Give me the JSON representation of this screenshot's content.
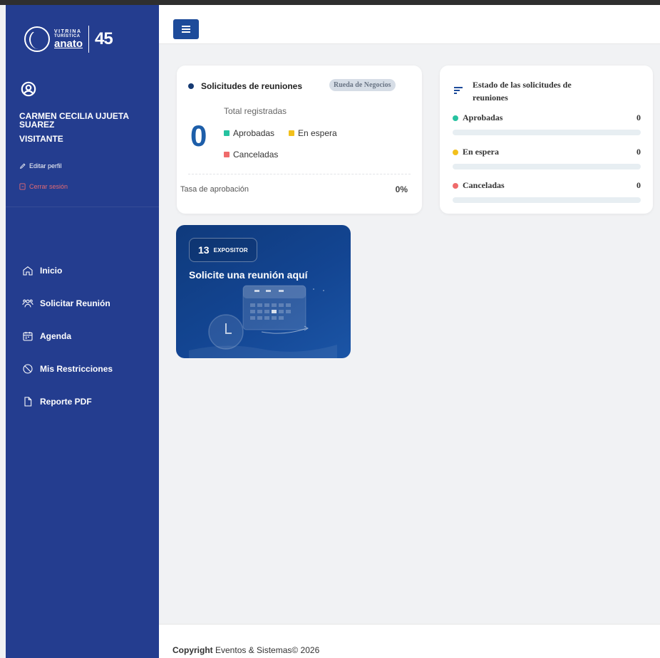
{
  "logo": {
    "line1": "VITRINA",
    "line2": "TURÍSTICA",
    "line3": "anato",
    "badge": "45"
  },
  "user": {
    "name": "CARMEN CECILIA UJUETA SUAREZ",
    "role": "VISITANTE",
    "edit_label": "Editar perfil",
    "logout_label": "Cerrar sesión"
  },
  "nav": {
    "items": [
      {
        "label": "Inicio",
        "icon": "home-icon"
      },
      {
        "label": "Solicitar Reunión",
        "icon": "users-icon"
      },
      {
        "label": "Agenda",
        "icon": "calendar-icon"
      },
      {
        "label": "Mis Restricciones",
        "icon": "block-icon"
      },
      {
        "label": "Reporte PDF",
        "icon": "file-icon"
      }
    ]
  },
  "summary": {
    "title": "Solicitudes de reuniones",
    "badge": "Rueda de Negocios",
    "total": "0",
    "total_label": "Total registradas",
    "legend": {
      "approved": "Aprobadas",
      "waiting": "En espera",
      "cancelled": "Canceladas"
    },
    "rate_label": "Tasa de aprobación",
    "rate_value": "0%"
  },
  "status": {
    "title": "Estado de las solicitudes de reuniones",
    "rows": [
      {
        "label": "Aprobadas",
        "value": "0",
        "fraction": 0,
        "color": "#26c2a0"
      },
      {
        "label": "En espera",
        "value": "0",
        "fraction": 0,
        "color": "#f2c01c"
      },
      {
        "label": "Canceladas",
        "value": "0",
        "fraction": 0,
        "color": "#ef6b6b"
      }
    ]
  },
  "promo": {
    "count": "13",
    "count_label": "EXPOSITOR",
    "title": "Solicite una reunión aquí"
  },
  "footer": {
    "bold": "Copyright",
    "rest": " Eventos & Sistemas© 2026"
  },
  "colors": {
    "sidebar": "#243d8f",
    "accent": "#1d4b9a",
    "approved": "#26c2a0",
    "waiting": "#f2c01c",
    "cancelled": "#ef6b6b"
  }
}
